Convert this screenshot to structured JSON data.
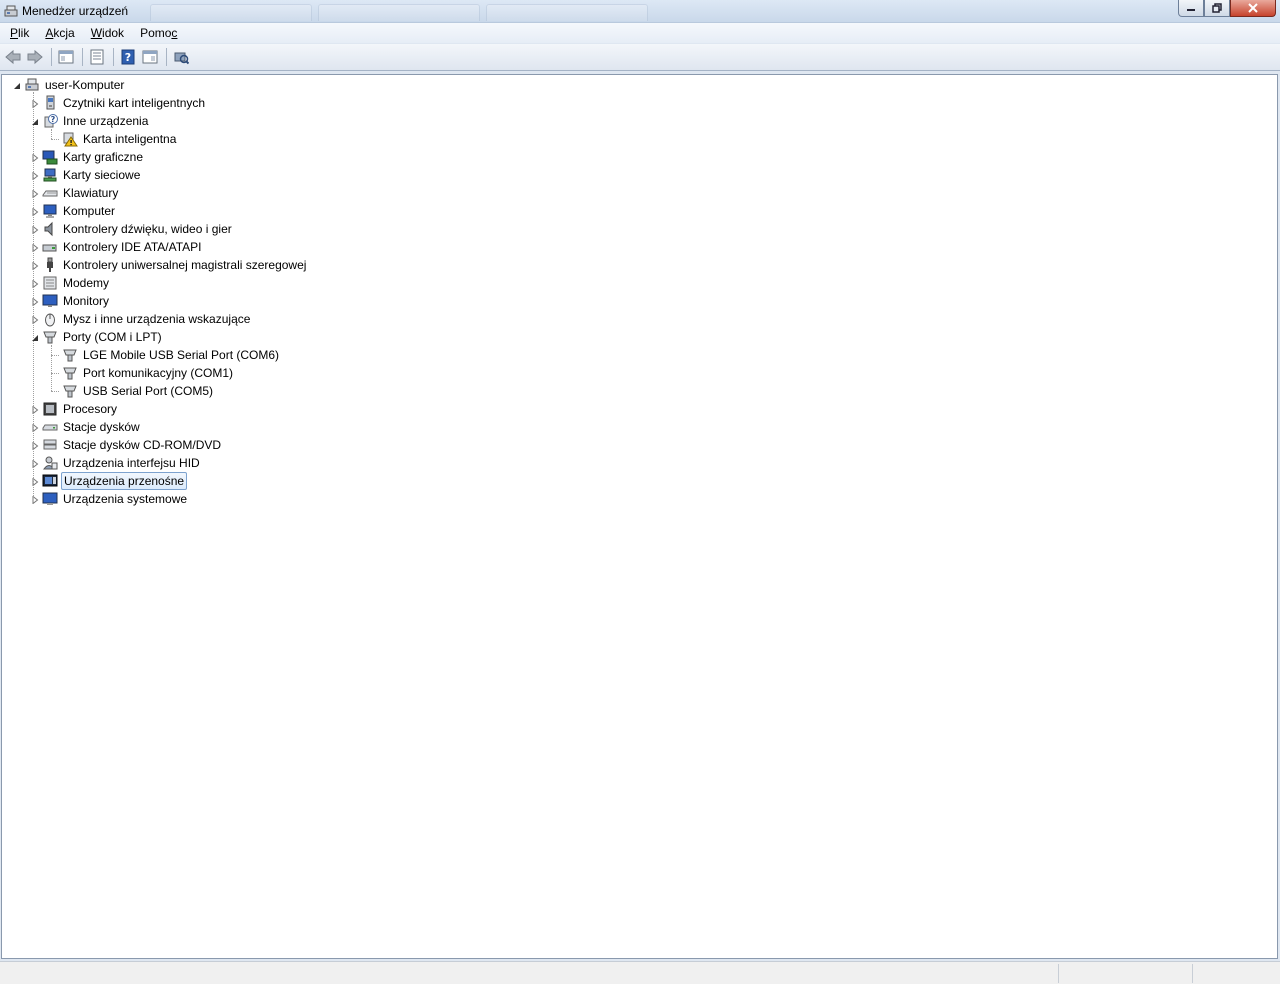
{
  "window": {
    "title": "Menedżer urządzeń"
  },
  "menu": [
    "Plik",
    "Akcja",
    "Widok",
    "Pomoc"
  ],
  "menu_mnemonic": [
    0,
    0,
    0,
    4
  ],
  "toolbar_icons": [
    "back-arrow-icon",
    "forward-arrow-icon",
    "show-hide-tree-icon",
    "properties-icon",
    "help-icon",
    "action-pane-icon",
    "scan-hardware-icon"
  ],
  "tree": {
    "root": "user-Komputer",
    "nodes": [
      {
        "label": "Czytniki kart inteligentnych",
        "level": 1,
        "expanded": false,
        "icon": "smart-card-reader-icon"
      },
      {
        "label": "Inne urządzenia",
        "level": 1,
        "expanded": true,
        "icon": "unknown-device-icon"
      },
      {
        "label": "Karta inteligentna",
        "level": 2,
        "icon": "warning-device-icon"
      },
      {
        "label": "Karty graficzne",
        "level": 1,
        "expanded": false,
        "icon": "display-adapter-icon"
      },
      {
        "label": "Karty sieciowe",
        "level": 1,
        "expanded": false,
        "icon": "network-adapter-icon"
      },
      {
        "label": "Klawiatury",
        "level": 1,
        "expanded": false,
        "icon": "keyboard-icon"
      },
      {
        "label": "Komputer",
        "level": 1,
        "expanded": false,
        "icon": "computer-icon"
      },
      {
        "label": "Kontrolery dźwięku, wideo i gier",
        "level": 1,
        "expanded": false,
        "icon": "speaker-icon"
      },
      {
        "label": "Kontrolery IDE ATA/ATAPI",
        "level": 1,
        "expanded": false,
        "icon": "ide-controller-icon"
      },
      {
        "label": "Kontrolery uniwersalnej magistrali szeregowej",
        "level": 1,
        "expanded": false,
        "icon": "usb-plug-icon"
      },
      {
        "label": "Modemy",
        "level": 1,
        "expanded": false,
        "icon": "modem-icon"
      },
      {
        "label": "Monitory",
        "level": 1,
        "expanded": false,
        "icon": "monitor-icon"
      },
      {
        "label": "Mysz i inne urządzenia wskazujące",
        "level": 1,
        "expanded": false,
        "icon": "mouse-icon"
      },
      {
        "label": "Porty (COM i LPT)",
        "level": 1,
        "expanded": true,
        "icon": "port-icon"
      },
      {
        "label": "LGE Mobile USB Serial Port (COM6)",
        "level": 2,
        "icon": "port-icon"
      },
      {
        "label": "Port komunikacyjny (COM1)",
        "level": 2,
        "icon": "port-icon"
      },
      {
        "label": "USB Serial Port (COM5)",
        "level": 2,
        "icon": "port-icon"
      },
      {
        "label": "Procesory",
        "level": 1,
        "expanded": false,
        "icon": "processor-icon"
      },
      {
        "label": "Stacje dysków",
        "level": 1,
        "expanded": false,
        "icon": "disk-drive-icon"
      },
      {
        "label": "Stacje dysków CD-ROM/DVD",
        "level": 1,
        "expanded": false,
        "icon": "cdrom-drive-icon"
      },
      {
        "label": "Urządzenia interfejsu HID",
        "level": 1,
        "expanded": false,
        "icon": "hid-icon"
      },
      {
        "label": "Urządzenia przenośne",
        "level": 1,
        "expanded": false,
        "selected": true,
        "icon": "portable-device-icon"
      },
      {
        "label": "Urządzenia systemowe",
        "level": 1,
        "expanded": false,
        "icon": "system-device-icon"
      }
    ]
  },
  "colors": {
    "selection_border": "#7da2ce",
    "selection_fill": "#dcebfc",
    "warning": "#f2c21b",
    "close_button": "#c7432c"
  }
}
